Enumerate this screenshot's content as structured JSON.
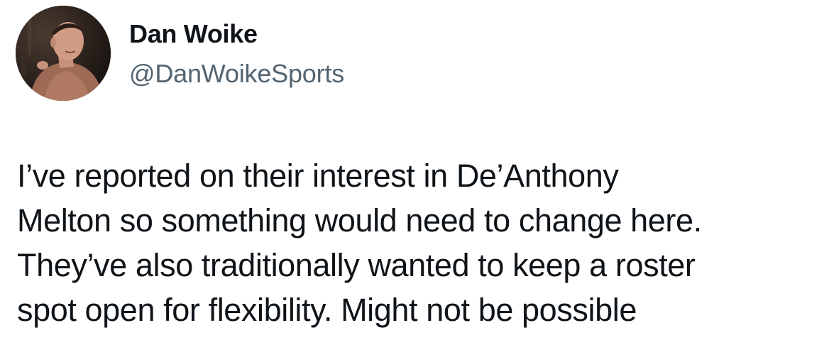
{
  "tweet": {
    "author": {
      "display_name": "Dan Woike",
      "handle": "@DanWoikeSports",
      "avatar_icon": "profile-photo"
    },
    "text_lines": [
      "I’ve reported on their interest in De’Anthony",
      "Melton so something would need to change here.",
      "They’ve also traditionally wanted to keep a roster",
      "spot open for flexibility. Might not be possible"
    ]
  },
  "colors": {
    "text_primary": "#0f1419",
    "text_secondary": "#536471",
    "background": "#ffffff"
  }
}
